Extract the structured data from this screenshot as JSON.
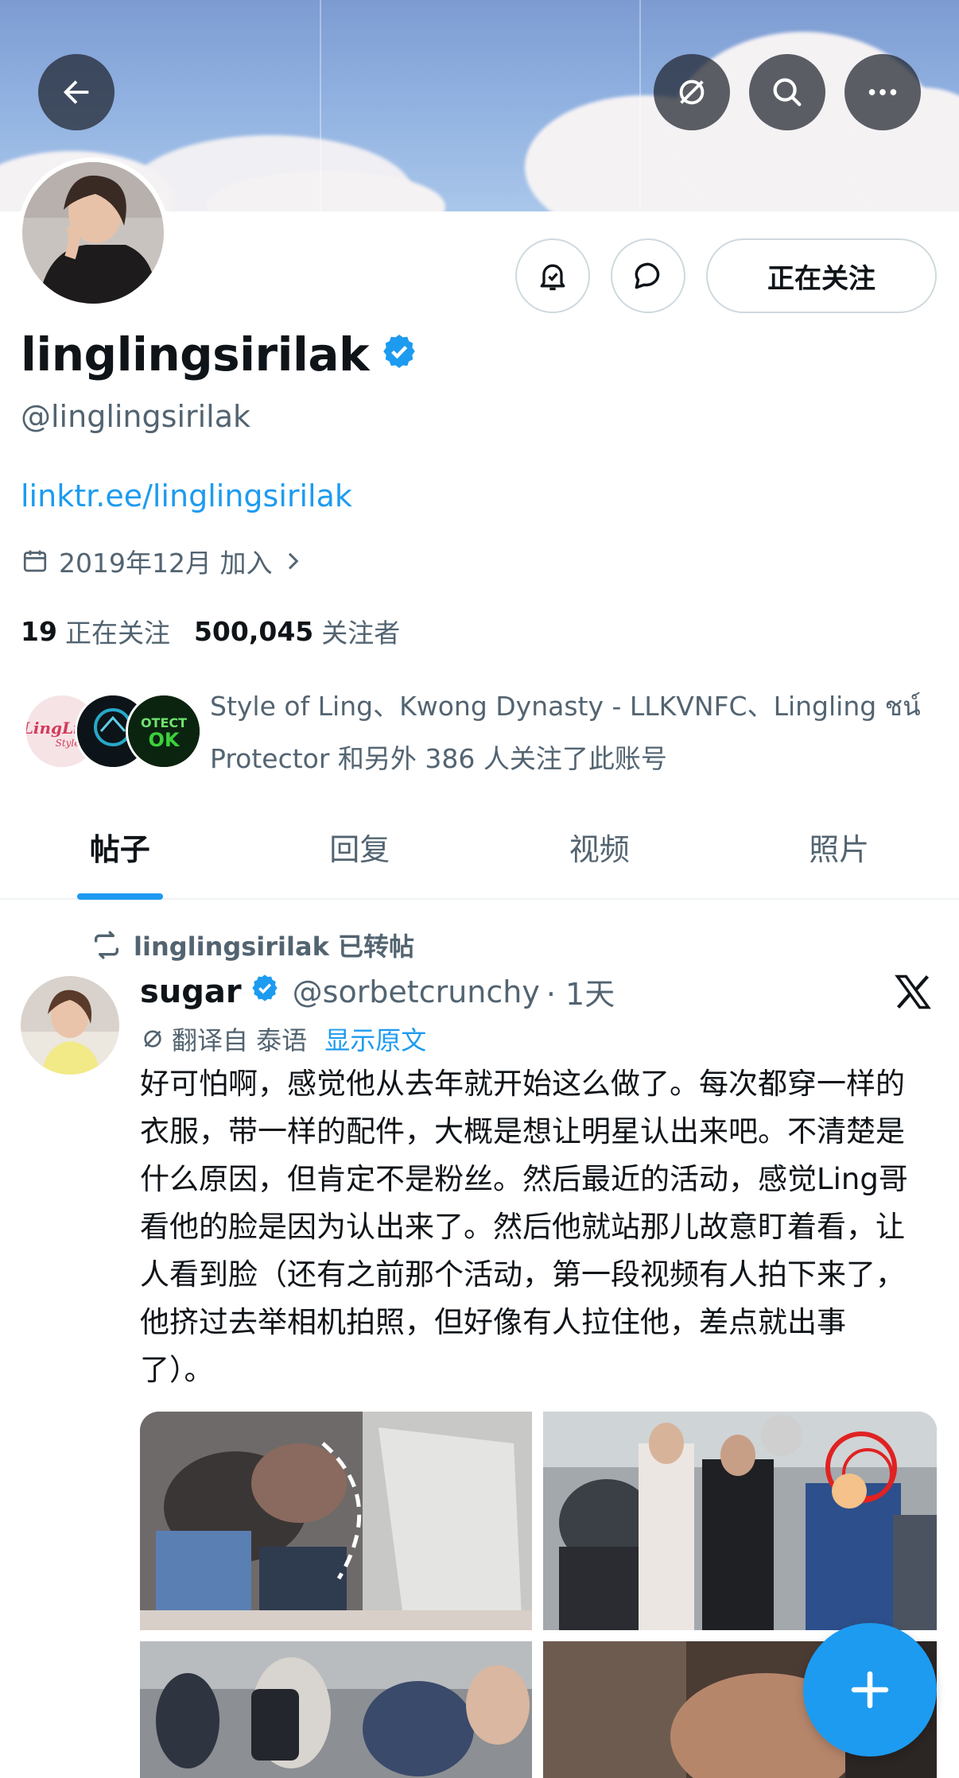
{
  "profile": {
    "display_name": "linglingsirilak",
    "handle": "@linglingsirilak",
    "link": "linktr.ee/linglingsirilak",
    "joined": "2019年12月 加入",
    "following_count": "19",
    "following_label": "正在关注",
    "followers_count": "500,045",
    "followers_label": "关注者",
    "follow_button": "正在关注",
    "followed_by_text": "Style of Ling、Kwong Dynasty - LLKVNFC、Lingling ชน์ Protector 和另外 386 人关注了此账号"
  },
  "tabs": [
    {
      "label": "帖子",
      "active": true
    },
    {
      "label": "回复",
      "active": false
    },
    {
      "label": "视频",
      "active": false
    },
    {
      "label": "照片",
      "active": false
    }
  ],
  "post": {
    "repost_label": "linglingsirilak 已转帖",
    "author_name": "sugar",
    "author_handle": "@sorbetcrunchy",
    "time": "· 1天",
    "translate_label": "翻译自 泰语",
    "show_original": "显示原文",
    "text": "好可怕啊，感觉他从去年就开始这么做了。每次都穿一样的衣服，带一样的配件，大概是想让明星认出来吧。不清楚是什么原因，但肯定不是粉丝。然后最近的活动，感觉Ling哥看他的脸是因为认出来了。然后他就站那儿故意盯着看，让人看到脸（还有之前那个活动，第一段视频有人拍下来了，他挤过去举相机拍照，但好像有人拉住他，差点就出事了）。"
  },
  "colors": {
    "accent": "#1d9bf0",
    "text_primary": "#0f1419",
    "text_secondary": "#536471",
    "border": "#cfd9de"
  },
  "icons": [
    "back-arrow-icon",
    "translate-icon",
    "search-icon",
    "more-icon",
    "notification-bell-icon",
    "message-icon",
    "verified-badge-icon",
    "calendar-icon",
    "chevron-right-icon",
    "repost-icon",
    "x-logo-icon",
    "plus-icon"
  ]
}
